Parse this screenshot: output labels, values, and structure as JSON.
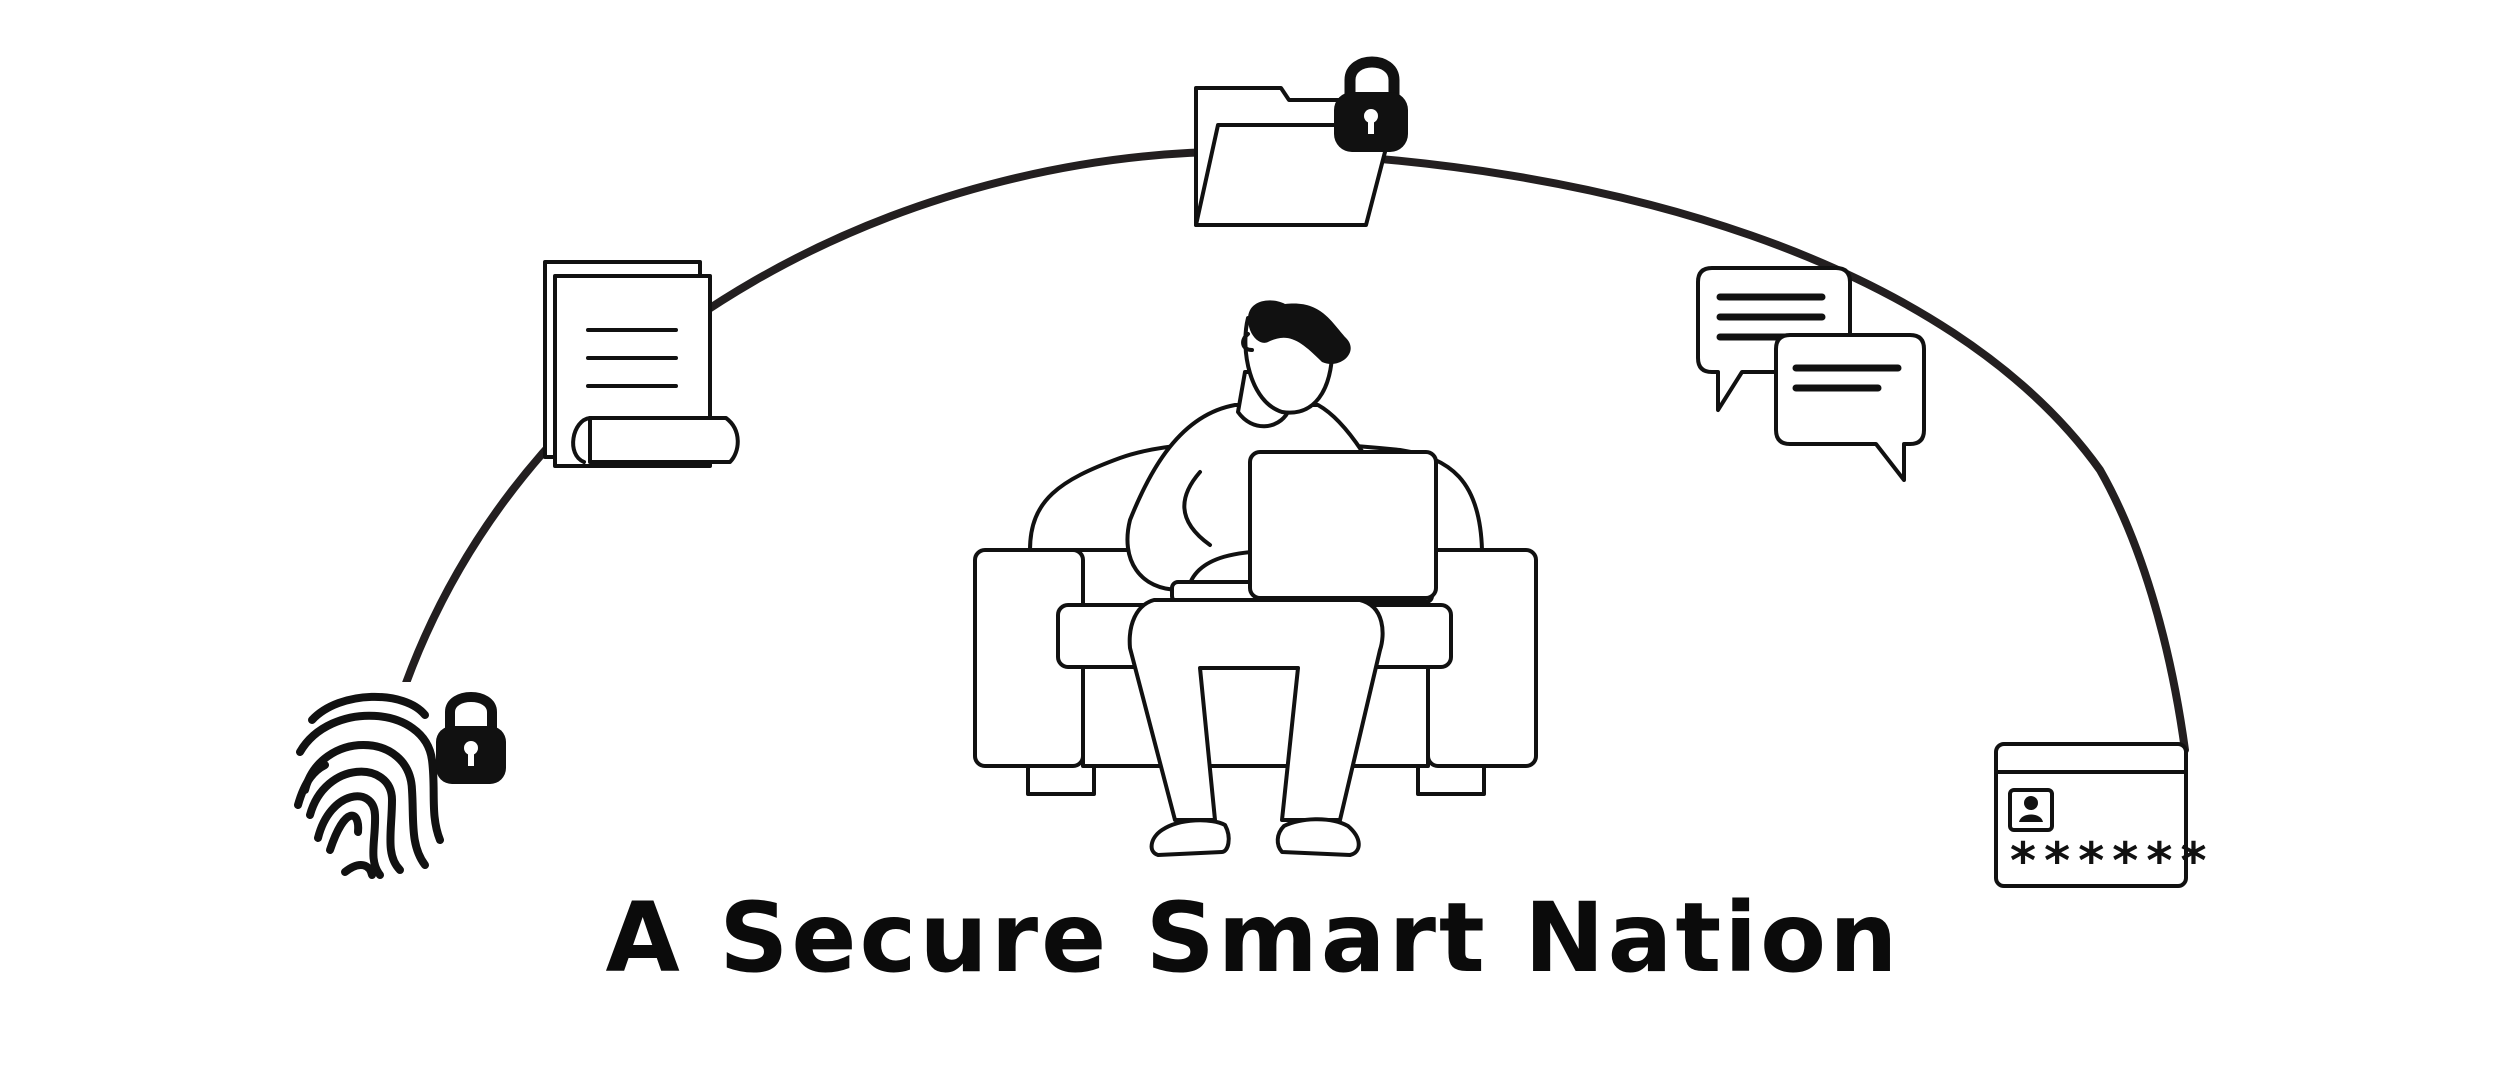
{
  "title": "A Secure Smart Nation",
  "password_card": {
    "masked_text": "******"
  },
  "colors": {
    "ink": "#111111",
    "arc": "#231f20",
    "background": "#ffffff"
  },
  "icons": [
    "fingerprint-icon",
    "padlock-icon",
    "document-scroll-icon",
    "folder-icon",
    "chat-bubbles-icon",
    "id-card-icon",
    "person-with-laptop-illustration",
    "sofa-illustration"
  ]
}
